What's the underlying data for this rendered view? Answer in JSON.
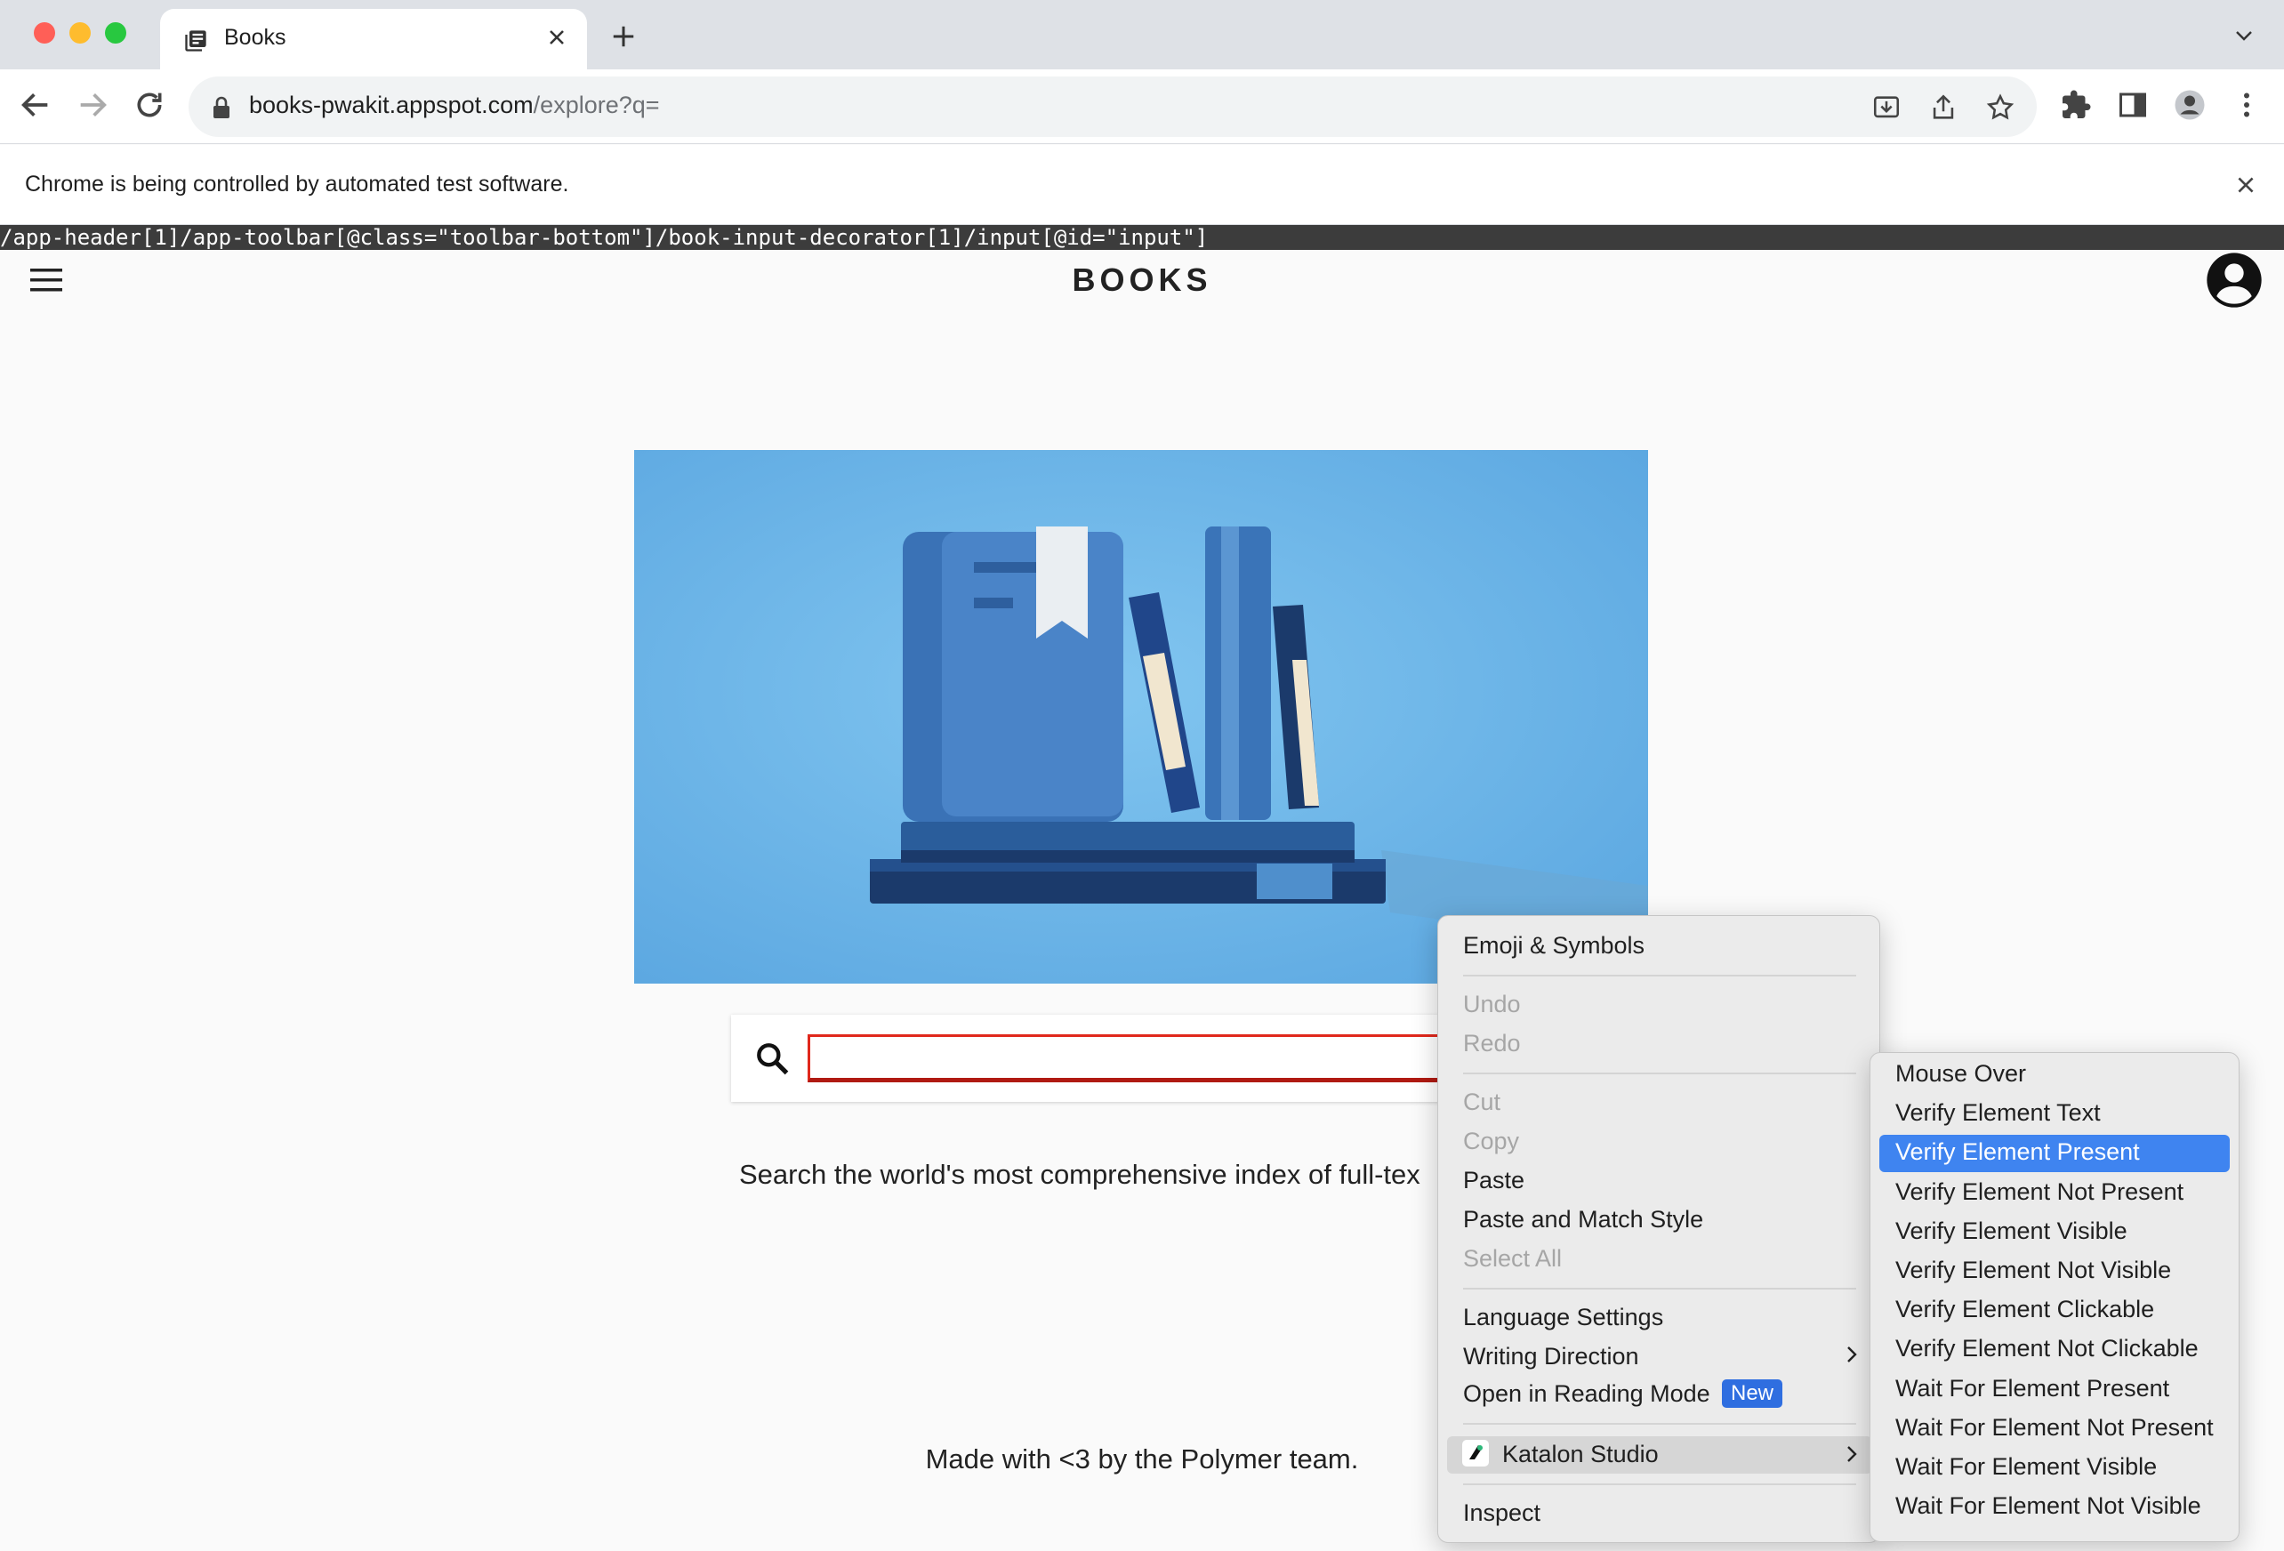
{
  "browser": {
    "tab_title": "Books",
    "url_host": "books-pwakit.appspot.com",
    "url_path": "/explore?q=",
    "infobar_text": "Chrome is being controlled by automated test software."
  },
  "xpath_overlay": "/app-header[1]/app-toolbar[@class=\"toolbar-bottom\"]/book-input-decorator[1]/input[@id=\"input\"]",
  "app": {
    "title": "BOOKS",
    "search_value": "",
    "tagline": "Search the world's most comprehensive index of full-tex",
    "footer": "Made with <3 by the Polymer team."
  },
  "context_menu": {
    "emoji": "Emoji & Symbols",
    "undo": "Undo",
    "redo": "Redo",
    "cut": "Cut",
    "copy": "Copy",
    "paste": "Paste",
    "paste_match": "Paste and Match Style",
    "select_all": "Select All",
    "language": "Language Settings",
    "writing_direction": "Writing Direction",
    "reading_mode": "Open in Reading Mode",
    "new_badge": "New",
    "katalon": "Katalon Studio",
    "inspect": "Inspect"
  },
  "katalon_submenu": {
    "selected_index": 2,
    "items": [
      "Mouse Over",
      "Verify Element Text",
      "Verify Element Present",
      "Verify Element Not Present",
      "Verify Element Visible",
      "Verify Element Not Visible",
      "Verify Element Clickable",
      "Verify Element Not Clickable",
      "Wait For Element Present",
      "Wait For Element Not Present",
      "Wait For Element Visible",
      "Wait For Element Not Visible"
    ]
  },
  "colors": {
    "hero_bg": "#70b8e8",
    "menu_selection": "#3f84f0",
    "new_badge": "#2f6ee0",
    "search_border": "#e0281c"
  }
}
